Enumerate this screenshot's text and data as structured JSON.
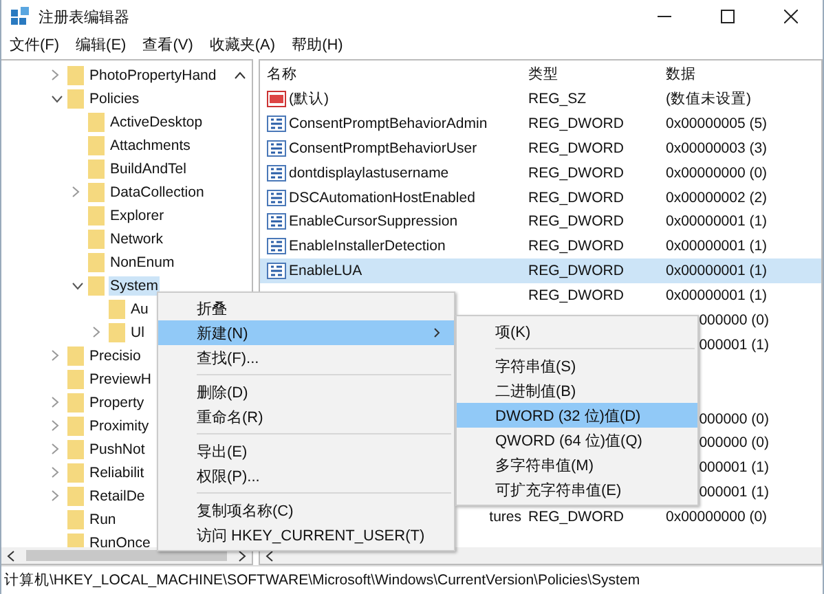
{
  "window": {
    "title": "注册表编辑器"
  },
  "menu_bar": [
    "文件(F)",
    "编辑(E)",
    "查看(V)",
    "收藏夹(A)",
    "帮助(H)"
  ],
  "tree": [
    {
      "label": "PhotoPropertyHand",
      "expanded": false,
      "selected": false
    },
    {
      "label": "Policies",
      "expanded": true,
      "selected": false,
      "children": [
        {
          "label": "ActiveDesktop",
          "selected": false
        },
        {
          "label": "Attachments",
          "selected": false
        },
        {
          "label": "BuildAndTel",
          "selected": false
        },
        {
          "label": "DataCollection",
          "expanded": false,
          "selected": false
        },
        {
          "label": "Explorer",
          "selected": false
        },
        {
          "label": "Network",
          "selected": false
        },
        {
          "label": "NonEnum",
          "selected": false
        },
        {
          "label": "System",
          "expanded": true,
          "selected": true,
          "children": [
            {
              "label": "Au",
              "selected": false
            },
            {
              "label": "Ul",
              "expanded": false,
              "selected": false
            }
          ]
        }
      ]
    },
    {
      "label": "Precisio",
      "expanded": false,
      "selected": false
    },
    {
      "label": "PreviewH",
      "selected": false
    },
    {
      "label": "Property",
      "expanded": false,
      "selected": false
    },
    {
      "label": "Proximity",
      "expanded": false,
      "selected": false
    },
    {
      "label": "PushNot",
      "expanded": false,
      "selected": false
    },
    {
      "label": "Reliabilit",
      "expanded": false,
      "selected": false
    },
    {
      "label": "RetailDe",
      "expanded": false,
      "selected": false
    },
    {
      "label": "Run",
      "selected": false
    },
    {
      "label": "RunOnce",
      "selected": false
    }
  ],
  "table": {
    "columns": [
      "名称",
      "类型",
      "数据"
    ],
    "rows": [
      {
        "kind": "sz",
        "name": "(默认)",
        "type": "REG_SZ",
        "data": "(数值未设置)",
        "selected": false
      },
      {
        "kind": "dword",
        "name": "ConsentPromptBehaviorAdmin",
        "type": "REG_DWORD",
        "data": "0x00000005 (5)",
        "selected": false
      },
      {
        "kind": "dword",
        "name": "ConsentPromptBehaviorUser",
        "type": "REG_DWORD",
        "data": "0x00000003 (3)",
        "selected": false
      },
      {
        "kind": "dword",
        "name": "dontdisplaylastusername",
        "type": "REG_DWORD",
        "data": "0x00000000 (0)",
        "selected": false
      },
      {
        "kind": "dword",
        "name": "DSCAutomationHostEnabled",
        "type": "REG_DWORD",
        "data": "0x00000002 (2)",
        "selected": false
      },
      {
        "kind": "dword",
        "name": "EnableCursorSuppression",
        "type": "REG_DWORD",
        "data": "0x00000001 (1)",
        "selected": false
      },
      {
        "kind": "dword",
        "name": "EnableInstallerDetection",
        "type": "REG_DWORD",
        "data": "0x00000001 (1)",
        "selected": false
      },
      {
        "kind": "dword",
        "name": "EnableLUA",
        "type": "REG_DWORD",
        "data": "0x00000001 (1)",
        "selected": true
      },
      {
        "kind": "blank",
        "type": "REG_DWORD",
        "data": "0x00000001 (1)",
        "selected": false
      },
      {
        "kind": "blank",
        "data": "000000 (0)",
        "selected": false
      },
      {
        "kind": "blank",
        "data": "000001 (1)",
        "selected": false
      },
      {
        "kind": "blank",
        "selected": false
      },
      {
        "kind": "blank",
        "selected": false
      },
      {
        "kind": "blank",
        "data": "000000 (0)",
        "selected": false
      },
      {
        "kind": "blank",
        "data": "000000 (0)",
        "selected": false
      },
      {
        "kind": "blank",
        "data": "000001 (1)",
        "selected": false
      },
      {
        "kind": "blank",
        "data": "000001 (1)",
        "selected": false
      },
      {
        "kind": "blank",
        "name": "tures",
        "type": "REG_DWORD",
        "data": "0x00000000 (0)",
        "selected": false
      }
    ]
  },
  "context_menu": [
    {
      "kind": "item",
      "label": "折叠",
      "selected": false
    },
    {
      "kind": "submenu",
      "label": "新建(N)",
      "selected": true
    },
    {
      "kind": "item",
      "label": "查找(F)...",
      "selected": false
    },
    {
      "kind": "separator"
    },
    {
      "kind": "item",
      "label": "删除(D)",
      "selected": false
    },
    {
      "kind": "item",
      "label": "重命名(R)",
      "selected": false
    },
    {
      "kind": "separator"
    },
    {
      "kind": "item",
      "label": "导出(E)",
      "selected": false
    },
    {
      "kind": "item",
      "label": "权限(P)...",
      "selected": false
    },
    {
      "kind": "separator"
    },
    {
      "kind": "item",
      "label": "复制项名称(C)",
      "selected": false
    },
    {
      "kind": "item",
      "label": "访问 HKEY_CURRENT_USER(T)",
      "selected": false
    }
  ],
  "submenu": [
    {
      "kind": "item",
      "label": "项(K)",
      "selected": false
    },
    {
      "kind": "separator"
    },
    {
      "kind": "item",
      "label": "字符串值(S)",
      "selected": false
    },
    {
      "kind": "item",
      "label": "二进制值(B)",
      "selected": false
    },
    {
      "kind": "item",
      "label": "DWORD (32 位)值(D)",
      "selected": true
    },
    {
      "kind": "item",
      "label": "QWORD (64 位)值(Q)",
      "selected": false
    },
    {
      "kind": "item",
      "label": "多字符串值(M)",
      "selected": false
    },
    {
      "kind": "item",
      "label": "可扩充字符串值(E)",
      "selected": false
    }
  ],
  "status_bar": "计算机\\HKEY_LOCAL_MACHINE\\SOFTWARE\\Microsoft\\Windows\\CurrentVersion\\Policies\\System"
}
